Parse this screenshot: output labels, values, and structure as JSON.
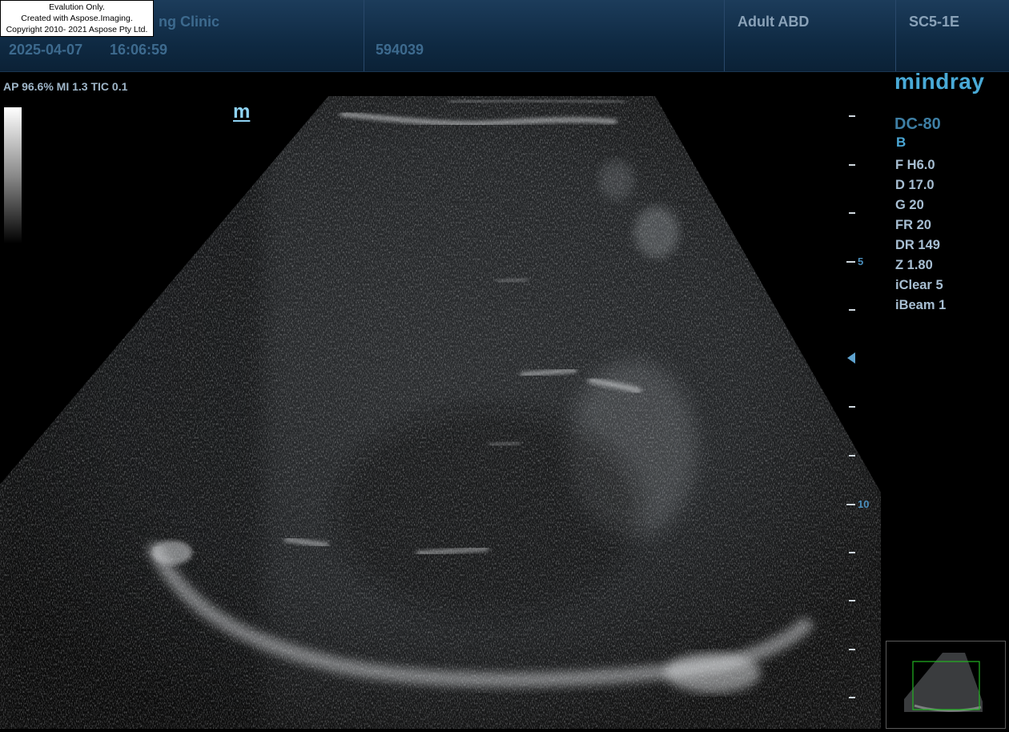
{
  "header": {
    "clinic": "ng Clinic",
    "date": "2025-04-07",
    "time": "16:06:59",
    "patient_id": "594039",
    "preset": "Adult ABD",
    "probe": "SC5-1E"
  },
  "watermark": {
    "line1": "Evalution Only.",
    "line2": "Created with Aspose.Imaging.",
    "line3": "Copyright 2010- 2021 Aspose Pty Ltd."
  },
  "power_readout": "AP 96.6%  MI 1.3 TIC 0.1",
  "orientation_marker": "m",
  "brand": {
    "logo": "mindray",
    "model": "DC-80",
    "mode": "B"
  },
  "parameters": [
    "F H6.0",
    "D 17.0",
    "G 20",
    "FR 20",
    "DR 149",
    "Z 1.80",
    "iClear 5",
    "iBeam 1"
  ],
  "depth_scale": {
    "labels": [
      "5",
      "10"
    ]
  },
  "icons": {
    "focus": "focus-pointer-icon",
    "grayscale": "grayscale-bar"
  },
  "colors": {
    "header_bg": "#0f2a43",
    "accent": "#49aad7",
    "param_text": "#a8bfd3"
  }
}
